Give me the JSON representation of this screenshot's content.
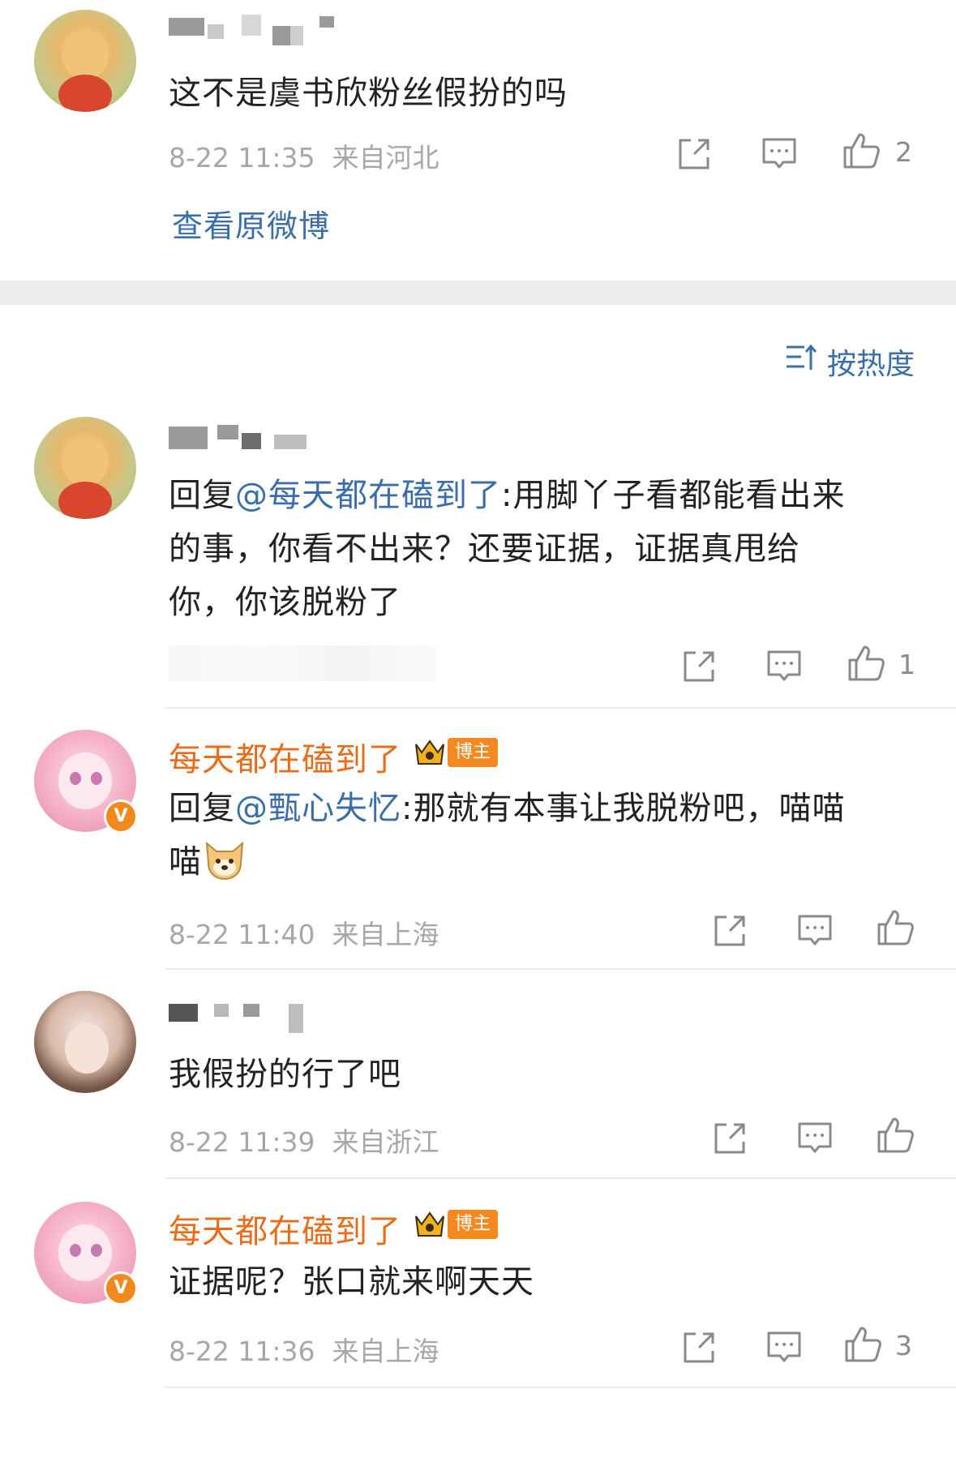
{
  "top_post": {
    "content": "这不是虞书欣粉丝假扮的吗",
    "time": "8-22 11:35",
    "location": "来自河北",
    "like_count": "2",
    "view_original": "查看原微博"
  },
  "sort_label": "按热度",
  "comments": [
    {
      "reply_prefix": "回复",
      "mention": "@每天都在磕到了",
      "text_line1": ":用脚丫子看都能看出来",
      "text_line2": "的事，你看不出来？还要证据，证据真甩给",
      "text_line3": "你，你该脱粉了",
      "like_count": "1"
    },
    {
      "username": "每天都在磕到了",
      "badge": "博主",
      "reply_prefix": "回复",
      "mention": "@甄心失忆",
      "text_line1": ":那就有本事让我脱粉吧，喵喵",
      "text_line2": "喵",
      "time": "8-22 11:40",
      "location": "来自上海"
    },
    {
      "text": "我假扮的行了吧",
      "time": "8-22 11:39",
      "location": "来自浙江"
    },
    {
      "username": "每天都在磕到了",
      "badge": "博主",
      "text": "证据呢？张口就来啊天天",
      "time": "8-22 11:36",
      "location": "来自上海",
      "like_count": "3"
    }
  ],
  "icons": [
    "share-icon",
    "comment-icon",
    "like-icon",
    "sort-icon",
    "crown-icon",
    "dog-emoji-icon",
    "verified-icon"
  ],
  "colors": {
    "username_orange": "#e86c1a",
    "link_blue": "#3b6ea8",
    "badge_orange": "#f4891f",
    "meta_gray": "#a7a7a7"
  }
}
